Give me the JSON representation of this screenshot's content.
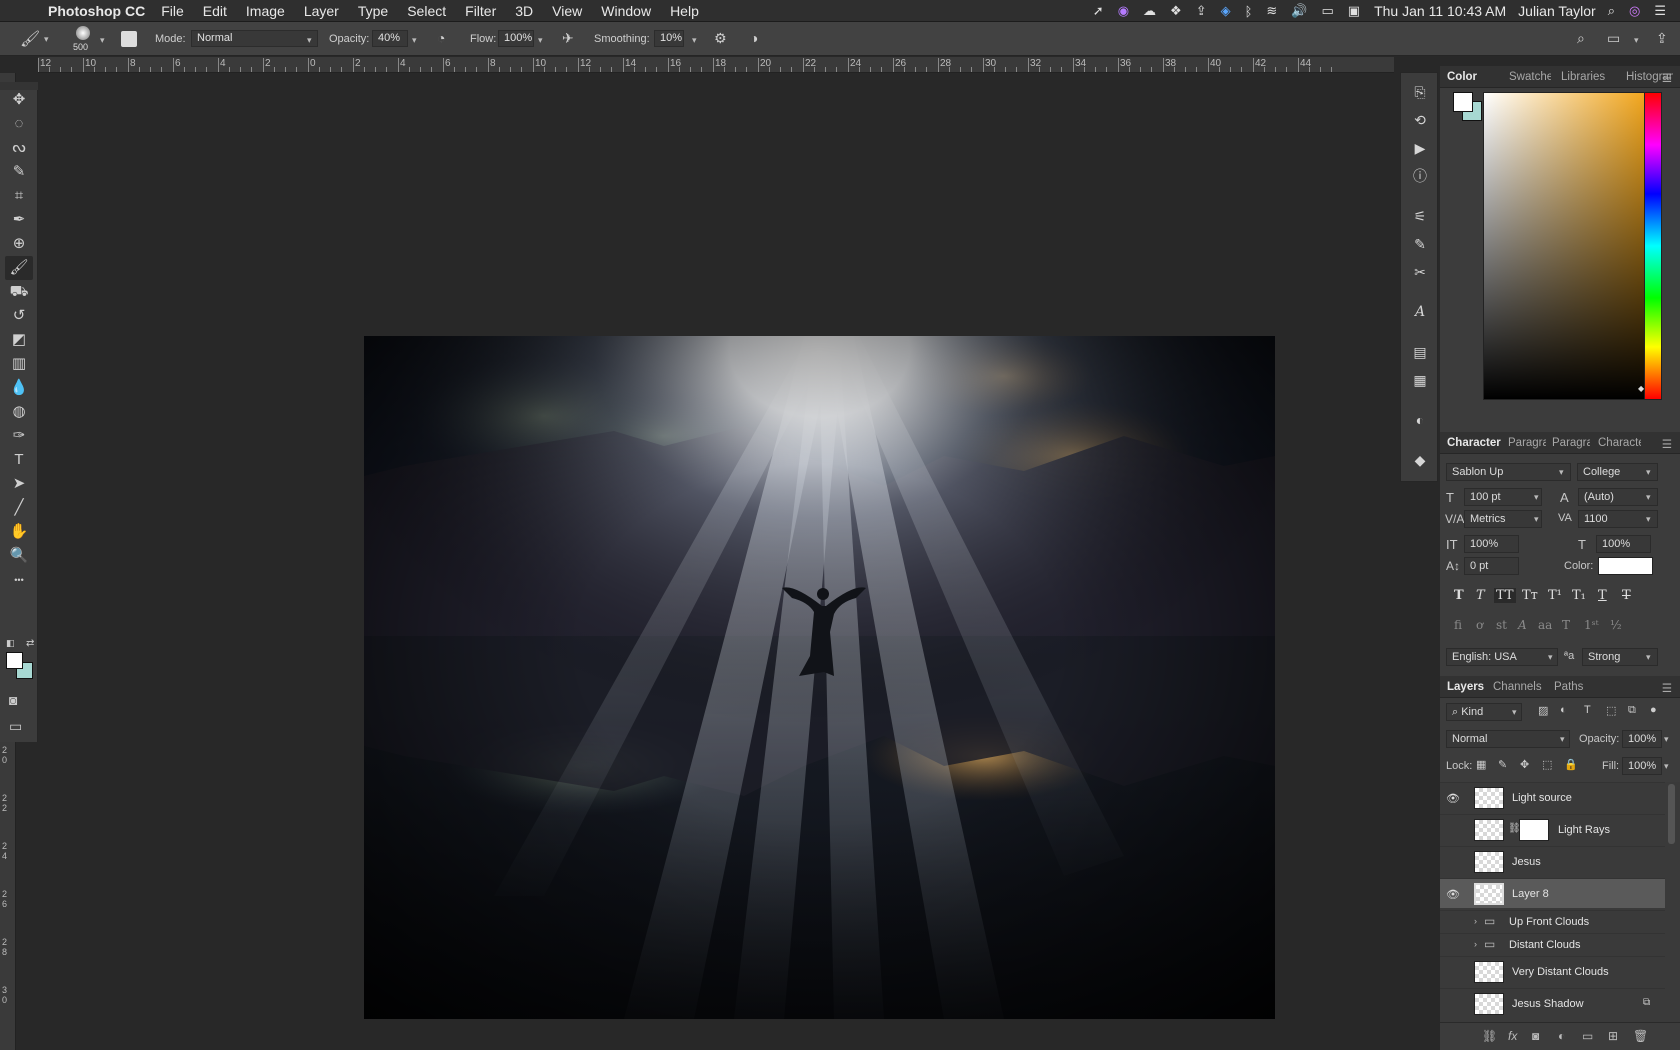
{
  "menubar": {
    "app_name": "Photoshop CC",
    "menus": [
      "File",
      "Edit",
      "Image",
      "Layer",
      "Type",
      "Select",
      "Filter",
      "3D",
      "View",
      "Window",
      "Help"
    ],
    "clock": "Thu Jan 11  10:43 AM",
    "user": "Julian Taylor",
    "tray_icons": [
      "location-icon",
      "creative-cloud-icon",
      "cloud-sync-icon",
      "dropbox-icon",
      "upload-icon",
      "vpn-icon",
      "bluetooth-icon",
      "wifi-icon",
      "volume-icon",
      "battery-icon",
      "display-icon",
      "search-icon",
      "siri-icon",
      "menu-icon"
    ]
  },
  "options_bar": {
    "brush_size": "500",
    "mode_label": "Mode:",
    "mode_value": "Normal",
    "opacity_label": "Opacity:",
    "opacity_value": "40%",
    "flow_label": "Flow:",
    "flow_value": "100%",
    "smoothing_label": "Smoothing:",
    "smoothing_value": "10%"
  },
  "rulers": {
    "top_ticks": [
      "12",
      "10",
      "8",
      "6",
      "4",
      "2",
      "0",
      "2",
      "4",
      "6",
      "8",
      "10",
      "12",
      "14",
      "16",
      "18",
      "20",
      "22",
      "24",
      "26",
      "28",
      "30",
      "32",
      "34",
      "36",
      "38",
      "40",
      "42",
      "44"
    ],
    "left_ticks": [
      "20",
      "22",
      "24",
      "26",
      "28",
      "30"
    ]
  },
  "toolbox": {
    "tools": [
      {
        "name": "move-tool",
        "glyph": "✥"
      },
      {
        "name": "marquee-tool",
        "glyph": "◌"
      },
      {
        "name": "lasso-tool",
        "glyph": "ᔓ"
      },
      {
        "name": "quick-select-tool",
        "glyph": "✎"
      },
      {
        "name": "crop-tool",
        "glyph": "⌗"
      },
      {
        "name": "eyedropper-tool",
        "glyph": "✒"
      },
      {
        "name": "healing-tool",
        "glyph": "⊕"
      },
      {
        "name": "brush-tool",
        "glyph": "🖌"
      },
      {
        "name": "stamp-tool",
        "glyph": "⛟"
      },
      {
        "name": "history-brush-tool",
        "glyph": "↺"
      },
      {
        "name": "eraser-tool",
        "glyph": "◩"
      },
      {
        "name": "gradient-tool",
        "glyph": "▥"
      },
      {
        "name": "blur-tool",
        "glyph": "💧"
      },
      {
        "name": "dodge-tool",
        "glyph": "◍"
      },
      {
        "name": "pen-tool",
        "glyph": "✑"
      },
      {
        "name": "type-tool",
        "glyph": "T"
      },
      {
        "name": "path-select-tool",
        "glyph": "➤"
      },
      {
        "name": "line-tool",
        "glyph": "╱"
      },
      {
        "name": "hand-tool",
        "glyph": "✋"
      },
      {
        "name": "zoom-tool",
        "glyph": "🔍"
      },
      {
        "name": "more-tools",
        "glyph": "•••"
      }
    ]
  },
  "panels": {
    "color_tabs": [
      "Color",
      "Swatches",
      "Libraries",
      "Histogram"
    ],
    "character_tabs": [
      "Character",
      "Paragraph",
      "Paragraph",
      "Character"
    ],
    "character": {
      "font_family": "Sablon Up",
      "font_style": "College",
      "font_size": "100 pt",
      "leading": "(Auto)",
      "kerning": "Metrics",
      "tracking": "1100",
      "vertical_scale": "100%",
      "horizontal_scale": "100%",
      "baseline_shift": "0 pt",
      "color_label": "Color:",
      "language": "English: USA",
      "antialias": "Strong"
    },
    "layers_tabs": [
      "Layers",
      "Channels",
      "Paths"
    ],
    "layers_filter": "Kind",
    "blend_mode": "Normal",
    "opacity_label": "Opacity:",
    "opacity_value": "100%",
    "lock_label": "Lock:",
    "fill_label": "Fill:",
    "fill_value": "100%",
    "layers": [
      {
        "name": "Light source",
        "visible": true
      },
      {
        "name": "Light Rays",
        "visible": false
      },
      {
        "name": "Jesus",
        "visible": false
      },
      {
        "name": "Layer 8",
        "visible": true
      },
      {
        "name": "Up Front Clouds",
        "visible": false
      },
      {
        "name": "Distant Clouds",
        "visible": false
      },
      {
        "name": "Very Distant Clouds",
        "visible": false
      },
      {
        "name": "Jesus Shadow",
        "visible": false
      }
    ]
  }
}
